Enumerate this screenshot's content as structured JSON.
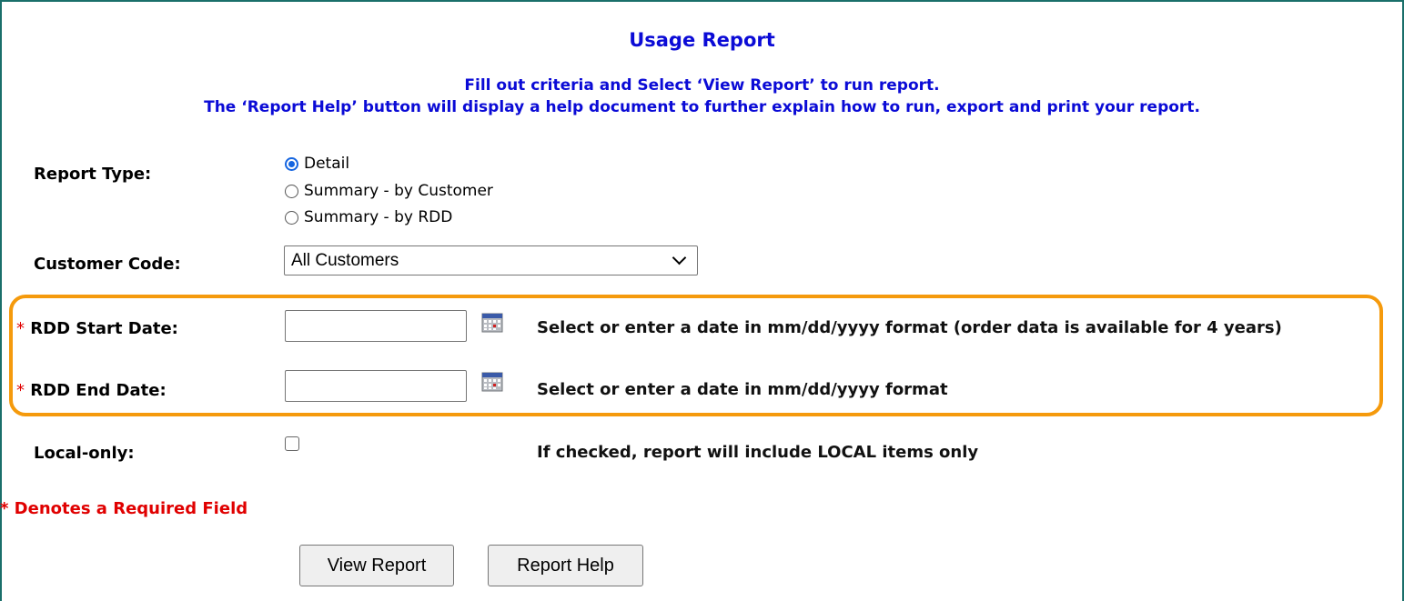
{
  "title": "Usage Report",
  "instructions": {
    "line1": "Fill out criteria and Select ‘View Report’ to run report.",
    "line2": "The ‘Report Help’ button will display a help document to further explain how to run, export and print your report."
  },
  "report_type": {
    "label": "Report Type:",
    "options": [
      {
        "label": "Detail",
        "checked": true
      },
      {
        "label": "Summary - by Customer",
        "checked": false
      },
      {
        "label": "Summary - by RDD",
        "checked": false
      }
    ]
  },
  "customer_code": {
    "label": "Customer Code:",
    "selected": "All Customers"
  },
  "rdd_start": {
    "required_mark": "*",
    "label": "RDD Start Date:",
    "value": "",
    "hint": "Select or enter a date in mm/dd/yyyy format (order data is available for 4 years)"
  },
  "rdd_end": {
    "required_mark": "*",
    "label": "RDD End Date:",
    "value": "",
    "hint": "Select or enter a date in mm/dd/yyyy format"
  },
  "local_only": {
    "label": "Local-only:",
    "checked": false,
    "hint": "If checked, report will include LOCAL items only"
  },
  "required_note": "* Denotes a Required Field",
  "buttons": {
    "view_report": "View Report",
    "report_help": "Report Help"
  },
  "colors": {
    "title_blue": "#0b0bd6",
    "required_red": "#e00000",
    "highlight_orange": "#f59a0c",
    "radio_blue": "#1565e0"
  },
  "icons": {
    "date_picker": "calendar-icon",
    "dropdown": "chevron-down-icon"
  }
}
